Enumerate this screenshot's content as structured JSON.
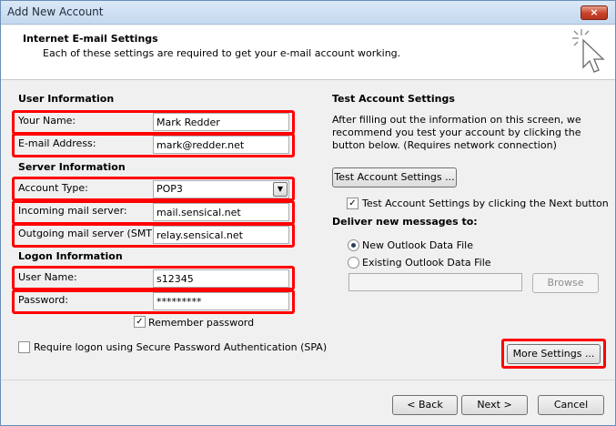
{
  "window": {
    "title": "Add New Account",
    "close_glyph": "×"
  },
  "header": {
    "title": "Internet E-mail Settings",
    "description": "Each of these settings are required to get your e-mail account working.",
    "icon": "cursor-sparkle-icon"
  },
  "user_info": {
    "title": "User Information",
    "name_label": "Your Name:",
    "name_value": "Mark Redder",
    "email_label": "E-mail Address:",
    "email_value": "mark@redder.net"
  },
  "server_info": {
    "title": "Server Information",
    "account_type_label": "Account Type:",
    "account_type_value": "POP3",
    "incoming_label": "Incoming mail server:",
    "incoming_value": "mail.sensical.net",
    "outgoing_label": "Outgoing mail server (SMTP):",
    "outgoing_value": "relay.sensical.net"
  },
  "logon_info": {
    "title": "Logon Information",
    "username_label": "User Name:",
    "username_value": "s12345",
    "password_label": "Password:",
    "password_value": "*********",
    "remember_label": "Remember password",
    "remember_checked": true,
    "spa_label": "Require logon using Secure Password Authentication (SPA)",
    "spa_checked": false
  },
  "test_settings": {
    "title": "Test Account Settings",
    "description": "After filling out the information on this screen, we recommend you test your account by clicking the button below. (Requires network connection)",
    "test_button": "Test Account Settings ...",
    "next_check_label": "Test Account Settings by clicking the Next button",
    "next_check_checked": true
  },
  "deliver": {
    "title": "Deliver new messages to:",
    "new_file_label": "New Outlook Data File",
    "new_file_selected": true,
    "existing_file_label": "Existing Outlook Data File",
    "existing_file_selected": false,
    "path_value": "",
    "browse_button": "Browse"
  },
  "buttons": {
    "more_settings": "More Settings ...",
    "back": "< Back",
    "next": "Next >",
    "cancel": "Cancel"
  },
  "colors": {
    "highlight": "#ff0000",
    "title_gradient": "#c5d8ef"
  }
}
